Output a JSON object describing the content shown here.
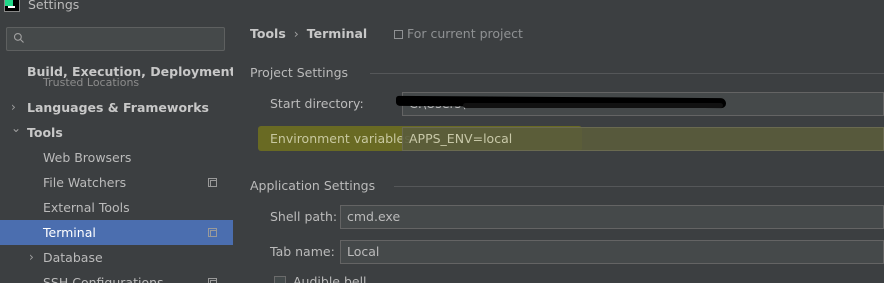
{
  "window": {
    "title": "Settings"
  },
  "search": {
    "placeholder": ""
  },
  "sidebar": {
    "ghost_label": "Trusted Locations",
    "items": [
      {
        "label": "Build, Execution, Deployment",
        "arrow": ""
      },
      {
        "label": "Languages & Frameworks",
        "arrow": "›"
      },
      {
        "label": "Tools",
        "arrow": "⌄"
      },
      {
        "label": "Web Browsers"
      },
      {
        "label": "File Watchers"
      },
      {
        "label": "External Tools"
      },
      {
        "label": "Terminal"
      },
      {
        "label": "Database",
        "arrow": "›"
      },
      {
        "label": "SSH Configurations"
      }
    ]
  },
  "breadcrumb": {
    "root": "Tools",
    "separator": "›",
    "current": "Terminal",
    "scope": "For current project"
  },
  "project_settings": {
    "title": "Project Settings",
    "start_directory_label": "Start directory:",
    "start_directory_value": "C:\\Users\\",
    "env_vars_label": "Environment variables:",
    "env_vars_value": "APPS_ENV=local"
  },
  "application_settings": {
    "title": "Application Settings",
    "shell_path_label": "Shell path:",
    "shell_path_value": "cmd.exe",
    "tab_name_label": "Tab name:",
    "tab_name_value": "Local",
    "audible_bell_label": "Audible bell"
  },
  "colors": {
    "selection": "#4b6eaf",
    "background": "#3c3f41",
    "highlight": "#a0a000"
  }
}
